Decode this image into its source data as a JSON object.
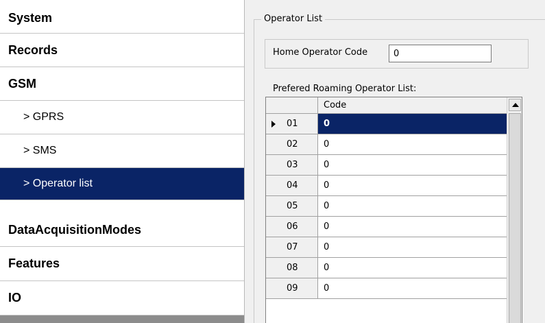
{
  "sidebar": {
    "items": [
      {
        "label": "System"
      },
      {
        "label": "Records"
      },
      {
        "label": "GSM"
      },
      {
        "label": "> GPRS"
      },
      {
        "label": "> SMS"
      },
      {
        "label": "> Operator list"
      },
      {
        "label": "DataAcquisitionModes"
      },
      {
        "label": "Features"
      },
      {
        "label": "IO"
      }
    ],
    "selected_index": 5
  },
  "operator_list": {
    "title": "Operator List",
    "home_operator_label": "Home Operator Code",
    "home_operator_value": "0",
    "roaming_label": "Prefered Roaming Operator List:",
    "grid": {
      "column_header": "Code",
      "selected_row": 0,
      "rows": [
        {
          "index": "01",
          "code": "0"
        },
        {
          "index": "02",
          "code": "0"
        },
        {
          "index": "03",
          "code": "0"
        },
        {
          "index": "04",
          "code": "0"
        },
        {
          "index": "05",
          "code": "0"
        },
        {
          "index": "06",
          "code": "0"
        },
        {
          "index": "07",
          "code": "0"
        },
        {
          "index": "08",
          "code": "0"
        },
        {
          "index": "09",
          "code": "0"
        }
      ]
    }
  },
  "colors": {
    "selection": "#0a2466",
    "panel_bg": "#f0f0f0"
  }
}
